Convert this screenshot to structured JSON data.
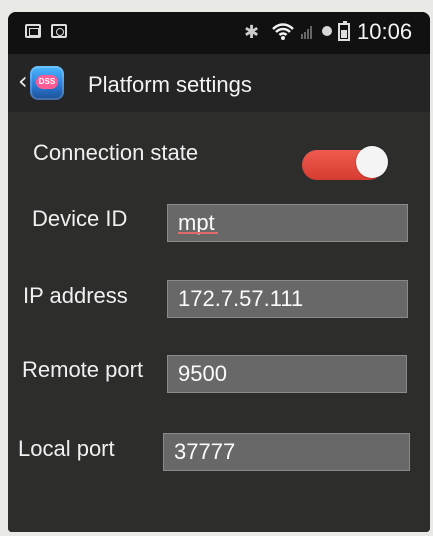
{
  "status_bar": {
    "time": "10:06"
  },
  "app_bar": {
    "title": "Platform settings",
    "logo_text": "DSS"
  },
  "settings": {
    "connection_state_label": "Connection state",
    "connection_state_enabled": true,
    "device_id_label": "Device ID",
    "device_id_value": "mpt",
    "ip_address_label": "IP address",
    "ip_address_value": "172.7.57.111",
    "remote_port_label": "Remote port",
    "remote_port_value": "9500",
    "local_port_label": "Local port",
    "local_port_value": "37777"
  },
  "colors": {
    "background": "#2d2d2c",
    "status_bar": "#111111",
    "input_fill": "#686868",
    "toggle_on": "#e4473b"
  },
  "icons": {
    "status_left_1": "screen-icon",
    "status_left_2": "settings-icon",
    "bluetooth": "bluetooth-icon",
    "wifi": "wifi-icon",
    "signal": "signal-icon",
    "battery": "battery-icon",
    "back": "chevron-left-icon"
  }
}
